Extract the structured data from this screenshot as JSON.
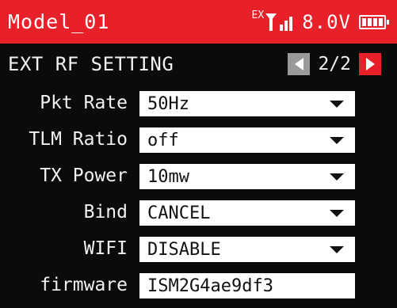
{
  "status": {
    "model_name": "Model_01",
    "ex_label": "EX",
    "voltage": "8.0V",
    "signal_icon": "signal-icon",
    "battery_icon": "battery-icon",
    "accent_color": "#e8202a"
  },
  "page": {
    "title": "EXT RF SETTING",
    "indicator": "2/2",
    "prev_icon": "triangle-left-icon",
    "next_icon": "triangle-right-icon"
  },
  "settings": [
    {
      "label": "Pkt Rate",
      "value": "50Hz",
      "dropdown": true
    },
    {
      "label": "TLM Ratio",
      "value": "off",
      "dropdown": true
    },
    {
      "label": "TX Power",
      "value": "10mw",
      "dropdown": true
    },
    {
      "label": "Bind",
      "value": "CANCEL",
      "dropdown": true
    },
    {
      "label": "WIFI",
      "value": "DISABLE",
      "dropdown": true
    },
    {
      "label": "firmware",
      "value": "ISM2G4ae9df3",
      "dropdown": false
    }
  ]
}
